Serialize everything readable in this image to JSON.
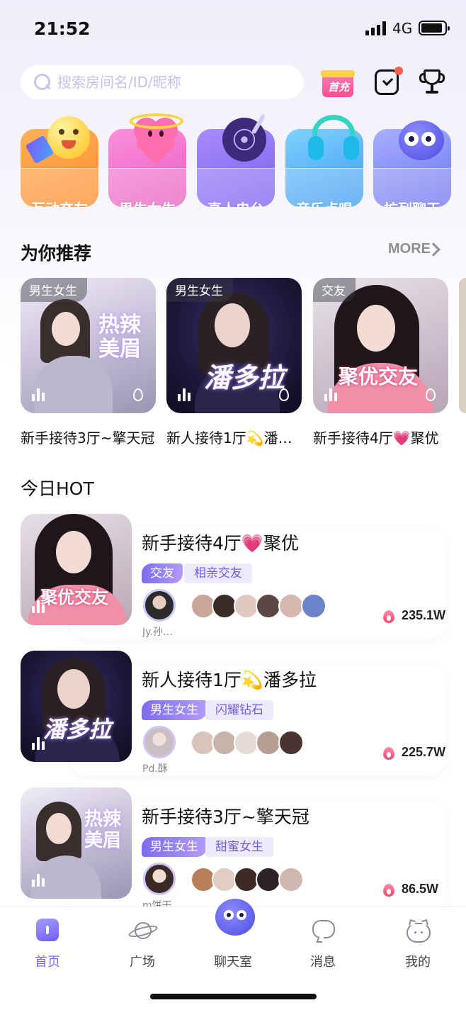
{
  "status_bar": {
    "time": "21:52",
    "network": "4G"
  },
  "search": {
    "placeholder": "搜索房间名/ID/昵称"
  },
  "header": {
    "recharge_label": "首充"
  },
  "categories": [
    {
      "label": "互动交友",
      "color": "#ff9d3b"
    },
    {
      "label": "男生女生",
      "color": "#f575c8"
    },
    {
      "label": "真人电台",
      "color": "#8e76f3"
    },
    {
      "label": "音乐点唱",
      "color": "#4fb7f2"
    },
    {
      "label": "扩列聊天",
      "color": "#7f86f6"
    }
  ],
  "recommend": {
    "title": "为你推荐",
    "more_label": "MORE",
    "items": [
      {
        "tag": "男生女生",
        "title": "新手接待3厅~擎天冠",
        "poster": "热辣美眉"
      },
      {
        "tag": "男生女生",
        "title": "新人接待1厅💫潘多拉",
        "poster": "潘多拉"
      },
      {
        "tag": "交友",
        "title": "新手接待4厅💗聚优",
        "poster": "聚优交友"
      }
    ]
  },
  "hot": {
    "title": "今日HOT",
    "items": [
      {
        "title": "新手接待4厅💗聚优",
        "tag_primary": "交友",
        "tag_secondary": "相亲交友",
        "host": "Jy.孙…",
        "count": "235.1W",
        "poster": "聚优交友"
      },
      {
        "title": "新人接待1厅💫潘多拉",
        "tag_primary": "男生女生",
        "tag_secondary": "闪耀钻石",
        "host": "Pd.酥",
        "count": "225.7W",
        "poster": "潘多拉"
      },
      {
        "title": "新手接待3厅~擎天冠",
        "tag_primary": "男生女生",
        "tag_secondary": "甜蜜女生",
        "host": "m饼干",
        "count": "86.5W",
        "poster": "热辣美眉"
      }
    ]
  },
  "tabs": [
    {
      "label": "首页",
      "active": true
    },
    {
      "label": "广场"
    },
    {
      "label": "聊天室"
    },
    {
      "label": "消息"
    },
    {
      "label": "我的"
    }
  ],
  "colors": {
    "accent": "#7a69f0",
    "tag_bg": "#eeeafd",
    "fire": "#f0466d"
  }
}
